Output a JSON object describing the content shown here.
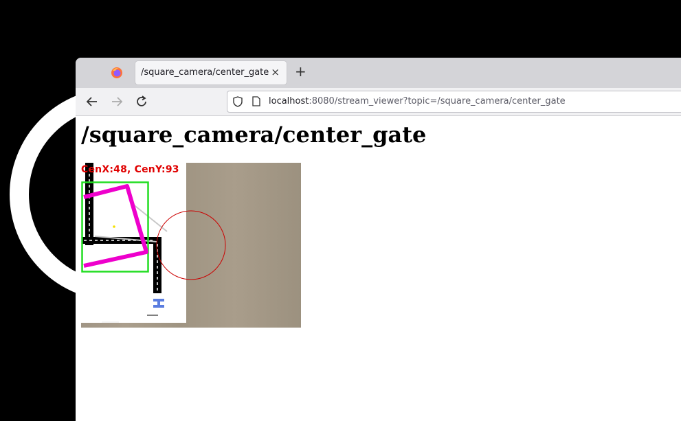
{
  "browser": {
    "tab_title": "/square_camera/center_gate",
    "tab_close": "×",
    "new_tab": "+",
    "url_host": "localhost",
    "url_rest": ":8080/stream_viewer?topic=/square_camera/center_gate"
  },
  "page": {
    "heading": "/square_camera/center_gate",
    "overlay_label": "CenX:48, CenY:93"
  },
  "colors": {
    "detection_box": "#22dd22",
    "gate_outline": "#ee00cc",
    "target_circle": "#cc0000",
    "label": "#e00000"
  }
}
